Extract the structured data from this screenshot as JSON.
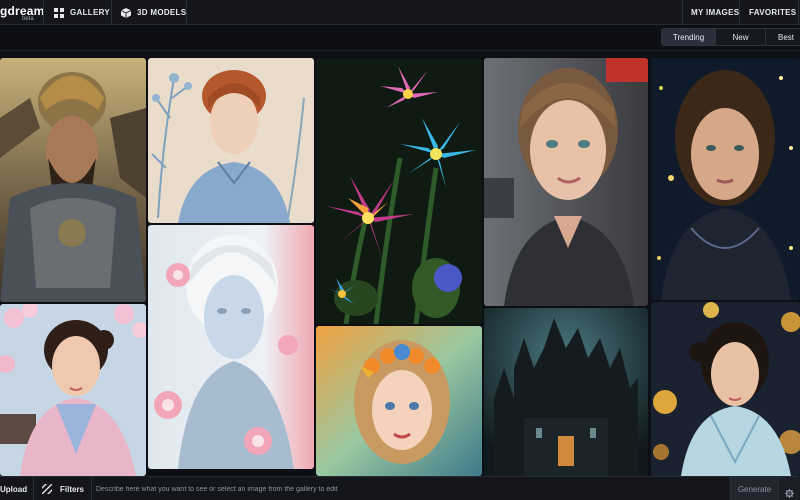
{
  "app": {
    "brand_name": "gdream",
    "brand_sub": "beta"
  },
  "nav": {
    "gallery_label": "GALLERY",
    "models_label": "3D MODELS",
    "my_images_label": "MY IMAGES",
    "favorites_label": "FAVORITES"
  },
  "sort": {
    "options": [
      "Trending",
      "New",
      "Best"
    ],
    "selected": "Trending"
  },
  "gallery": {
    "tiles": [
      {
        "name": "spartan-warrior",
        "icon": "warrior-image"
      },
      {
        "name": "redhead-botanical-portrait",
        "icon": "portrait-image"
      },
      {
        "name": "neon-flowers",
        "icon": "flower-image"
      },
      {
        "name": "girl-street-portrait",
        "icon": "portrait-image"
      },
      {
        "name": "night-sparkle-portrait",
        "icon": "portrait-image"
      },
      {
        "name": "asian-girl-cherry-blossom",
        "icon": "portrait-image"
      },
      {
        "name": "white-frozen-woman",
        "icon": "portrait-image"
      },
      {
        "name": "flower-crown-girl",
        "icon": "portrait-image"
      },
      {
        "name": "dark-gothic-castle",
        "icon": "castle-image"
      },
      {
        "name": "asian-girl-bokeh",
        "icon": "portrait-image"
      }
    ]
  },
  "bottom": {
    "upload_label": "Upload",
    "filters_label": "Filters",
    "prompt_placeholder": "Describe here what you want to see or select an image from the gallery to edit",
    "prompt_value": "",
    "generate_label": "Generate"
  },
  "colors": {
    "background": "#0d0f14",
    "bar": "#14161c",
    "active_sort": "#2a2f3b"
  }
}
